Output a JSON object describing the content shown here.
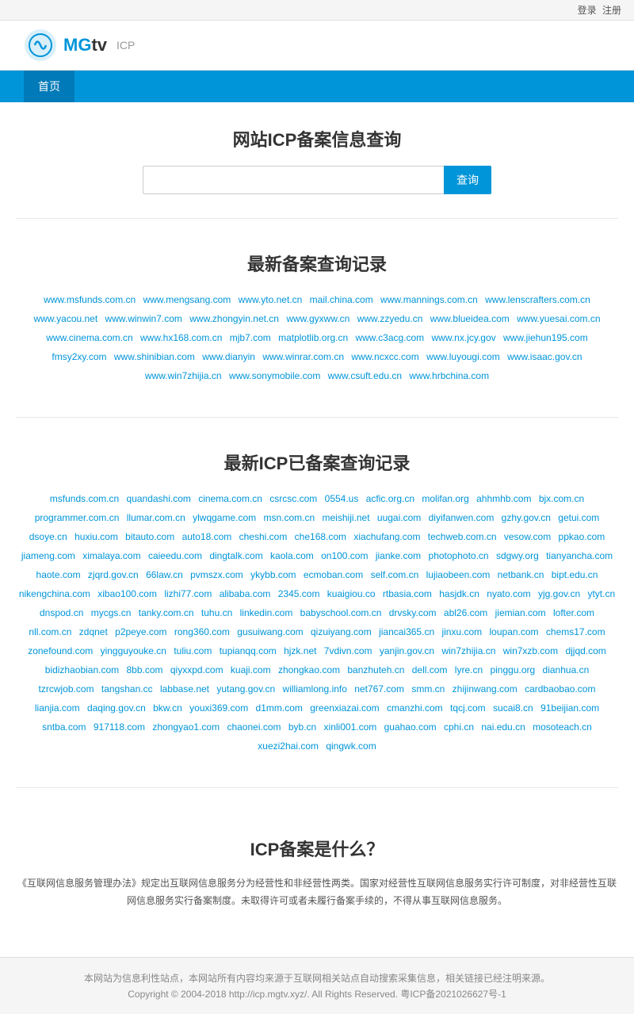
{
  "topbar": {
    "login": "登录",
    "register": "注册"
  },
  "header": {
    "logo_text": "MGtv",
    "logo_icp": "ICP"
  },
  "nav": {
    "items": [
      {
        "label": "首页",
        "active": true
      }
    ]
  },
  "search_section": {
    "title": "网站ICP备案信息查询",
    "input_placeholder": "",
    "button_label": "查询"
  },
  "recent_query": {
    "title": "最新备案查询记录",
    "links": [
      "www.msfunds.com.cn",
      "www.mengsang.com",
      "www.yto.net.cn",
      "mail.china.com",
      "www.mannings.com.cn",
      "www.lenscrafters.com.cn",
      "www.yacou.net",
      "www.winwin7.com",
      "www.zhongyin.net.cn",
      "www.gyxww.cn",
      "www.zzyedu.cn",
      "www.blueidea.com",
      "www.yuesai.com.cn",
      "www.cinema.com.cn",
      "www.hx168.com.cn",
      "mjb7.com",
      "matplotlib.org.cn",
      "www.c3acg.com",
      "www.nx.jcy.gov",
      "www.jiehun195.com",
      "fmsy2xy.com",
      "www.shinibian.com",
      "www.dianyin",
      "www.winrar.com.cn",
      "www.ncxcc.com",
      "www.luyougi.com",
      "www.isaac.gov.cn",
      "www.win7zhijia.cn",
      "www.sonymobile.com",
      "www.csuft.edu.cn",
      "www.hrbchina.com"
    ]
  },
  "icp_query": {
    "title": "最新ICP已备案查询记录",
    "links": [
      "msfunds.com.cn",
      "quandashi.com",
      "cinema.com.cn",
      "csrcsc.com",
      "0554.us",
      "acfic.org.cn",
      "molifan.org",
      "ahhmhb.com",
      "bjx.com.cn",
      "programmer.com.cn",
      "llumar.com.cn",
      "ylwqgame.com",
      "msn.com.cn",
      "meishiji.net",
      "uugai.com",
      "diyifanwen.com",
      "gzhy.gov.cn",
      "getui.com",
      "dsoye.cn",
      "huxiu.com",
      "bitauto.com",
      "auto18.com",
      "cheshi.com",
      "che168.com",
      "xiachufang.com",
      "techweb.com.cn",
      "vesow.com",
      "ppkao.com",
      "jiameng.com",
      "ximalaya.com",
      "caieedu.com",
      "dingtalk.com",
      "kaola.com",
      "on100.com",
      "jianke.com",
      "photophoto.cn",
      "sdgwy.org",
      "tianyancha.com",
      "haote.com",
      "zjqrd.gov.cn",
      "66law.cn",
      "pvmszx.com",
      "ykybb.com",
      "ecmoban.com",
      "self.com.cn",
      "lujiaobeen.com",
      "netbank.cn",
      "bipt.edu.cn",
      "nikengchina.com",
      "xibao100.com",
      "lizhi77.com",
      "alibaba.com",
      "2345.com",
      "kuaigiou.co",
      "rtbasia.com",
      "hasjdk.cn",
      "nyato.com",
      "yjg.gov.cn",
      "ytyt.cn",
      "dnspod.cn",
      "mycgs.cn",
      "tanky.com.cn",
      "tuhu.cn",
      "linkedin.com",
      "babyschool.com.cn",
      "drvsky.com",
      "abl26.com",
      "jiemian.com",
      "lofter.com",
      "nll.com.cn",
      "zdqnet",
      "p2peye.com",
      "rong360.com",
      "gusuiwang.com",
      "qizuiyang.com",
      "jiancai365.cn",
      "jinxu.com",
      "loupan.com",
      "chems17.com",
      "zonefound.com",
      "yingguyouke.cn",
      "tuliu.com",
      "tupianqq.com",
      "hjzk.net",
      "7vdivn.com",
      "yanjin.gov.cn",
      "win7zhijia.cn",
      "win7xzb.com",
      "djjqd.com",
      "bidizhaobian.com",
      "8bb.com",
      "qiyxxpd.com",
      "kuaji.com",
      "zhongkao.com",
      "banzhuteh.cn",
      "dell.com",
      "lyre.cn",
      "pinggu.org",
      "dianhua.cn",
      "tzrcwjob.com",
      "tangshan.cc",
      "labbase.net",
      "yutang.gov.cn",
      "williamlong.info",
      "net767.com",
      "smm.cn",
      "zhijinwang.com",
      "cardbaobao.com",
      "lianjia.com",
      "daqing.gov.cn",
      "bkw.cn",
      "youxi369.com",
      "d1mm.com",
      "greenxiazai.com",
      "cmanzhi.com",
      "tqcj.com",
      "sucai8.cn",
      "91beijian.com",
      "sntba.com",
      "917118.com",
      "zhongyao1.com",
      "chaonei.com",
      "byb.cn",
      "xinli001.com",
      "guahao.com",
      "cphi.cn",
      "nai.edu.cn",
      "mosoteach.cn",
      "xuezi2hai.com",
      "qingwk.com"
    ]
  },
  "icp_info": {
    "title": "ICP备案是什么？",
    "content": "《互联网信息服务管理办法》规定出互联网信息服务分为经营性和非经营性两类。国家对经营性互联网信息服务实行许可制度，对非经营性互联网信息服务实行备案制度。未取得许可或者未履行备案手续的，不得从事互联网信息服务。"
  },
  "footer": {
    "disclaimer": "本网站为信息利性站点，本网站所有内容均来源于互联网相关站点自动搜索采集信息，相关链接已经注明来源。",
    "copyright": "Copyright © 2004-2018 http://icp.mgtv.xyz/. All Rights Reserved. 粤ICP备2021026627号-1"
  }
}
